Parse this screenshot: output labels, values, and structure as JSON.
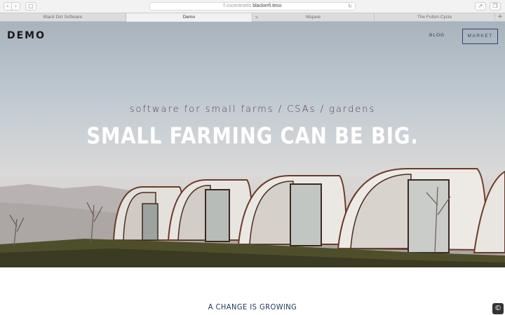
{
  "browser": {
    "url_prefix": "f·cscentroels",
    "url_host": "blackerfi.teso",
    "reload_icon": "reload-icon",
    "tabs": [
      {
        "label": "Black Dirt Software",
        "active": false
      },
      {
        "label": "Demo",
        "active": true
      },
      {
        "label": "Mojave",
        "active": false
      },
      {
        "label": "The Fulton Cycle",
        "active": false
      }
    ],
    "new_tab_label": "+"
  },
  "site": {
    "logo": "DEMO",
    "nav": {
      "blog": "BLOG",
      "market": "MARKET"
    }
  },
  "hero": {
    "tagline": "software for small farms / CSAs / gardens",
    "headline": "SMALL FARMING CAN BE BIG."
  },
  "section": {
    "title": "A CHANGE IS GROWING"
  },
  "help_badge": {
    "icon": "help-icon",
    "glyph": "©"
  },
  "colors": {
    "accent_navy": "#2d4470",
    "tagline": "#5e3b4a",
    "headline": "#ffffff"
  }
}
